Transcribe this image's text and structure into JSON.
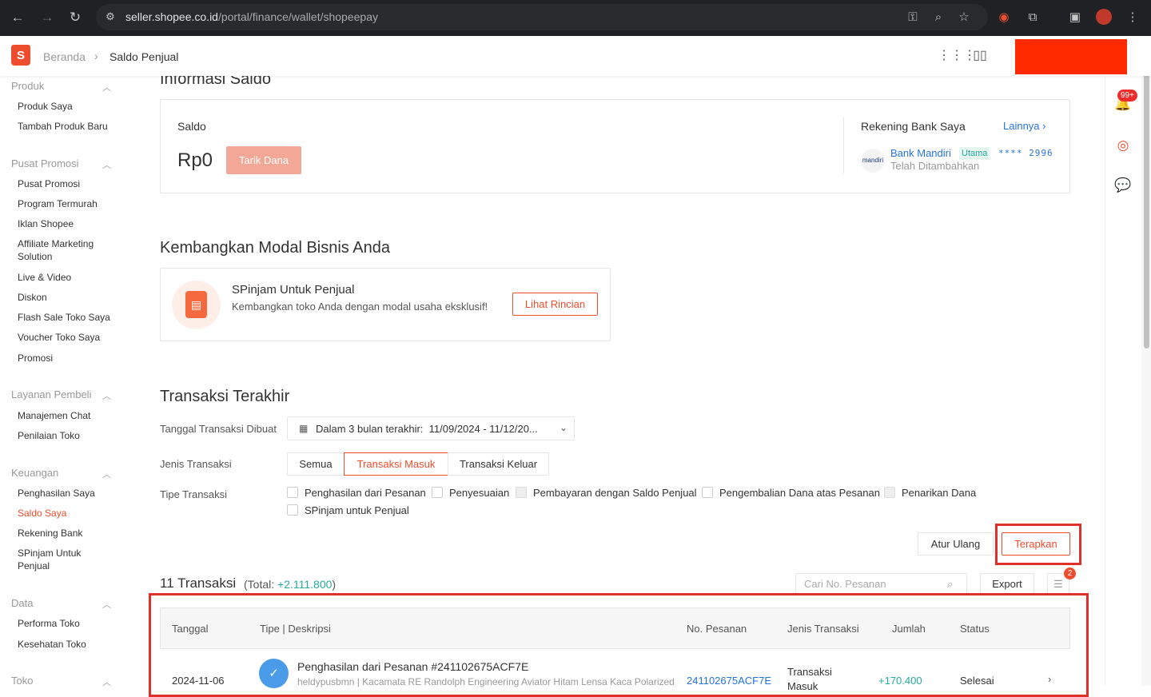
{
  "browser": {
    "url_host": "seller.shopee.co.id",
    "url_path": "/portal/finance/wallet/shopeepay"
  },
  "header": {
    "breadcrumb_home": "Beranda",
    "breadcrumb_current": "Saldo Penjual"
  },
  "sidebar": {
    "sections": [
      {
        "title": "Produk",
        "items": [
          "Produk Saya",
          "Tambah Produk Baru"
        ]
      },
      {
        "title": "Pusat Promosi",
        "items": [
          "Pusat Promosi",
          "Program Termurah",
          "Iklan Shopee",
          "Affiliate Marketing Solution",
          "Live & Video",
          "Diskon",
          "Flash Sale Toko Saya",
          "Voucher Toko Saya",
          "Promosi"
        ]
      },
      {
        "title": "Layanan Pembeli",
        "items": [
          "Manajemen Chat",
          "Penilaian Toko"
        ]
      },
      {
        "title": "Keuangan",
        "items": [
          "Penghasilan Saya",
          "Saldo Saya",
          "Rekening Bank",
          "SPinjam Untuk Penjual"
        ]
      },
      {
        "title": "Data",
        "items": [
          "Performa Toko",
          "Kesehatan Toko"
        ]
      },
      {
        "title": "Toko",
        "items": []
      }
    ],
    "active_item": "Saldo Saya"
  },
  "rail": {
    "notification_badge": "99+"
  },
  "info": {
    "title": "Informasi Saldo",
    "saldo_label": "Saldo",
    "amount": "Rp0",
    "withdraw_button": "Tarik Dana",
    "bank_title": "Rekening Bank Saya",
    "more_link": "Lainnya",
    "bank_logo_text": "mandiri",
    "bank_name": "Bank Mandiri",
    "bank_tag": "Utama",
    "bank_account": "**** 2996",
    "bank_status": "Telah Ditambahkan"
  },
  "capital": {
    "title": "Kembangkan Modal Bisnis Anda",
    "card_title": "SPinjam Untuk Penjual",
    "card_desc": "Kembangkan toko Anda dengan modal usaha eksklusif!",
    "card_button": "Lihat Rincian"
  },
  "transactions": {
    "title": "Transaksi Terakhir",
    "date_label": "Tanggal Transaksi Dibuat",
    "date_prefix": "Dalam 3 bulan terakhir:",
    "date_range": "11/09/2024 - 11/12/20...",
    "type_label": "Jenis Transaksi",
    "type_options": [
      "Semua",
      "Transaksi Masuk",
      "Transaksi Keluar"
    ],
    "type_selected": "Transaksi Masuk",
    "kind_label": "Tipe Transaksi",
    "kind_options": [
      "Penghasilan dari Pesanan",
      "Penyesuaian",
      "Pembayaran dengan Saldo Penjual",
      "Pengembalian Dana atas Pesanan",
      "Penarikan Dana",
      "SPinjam untuk Penjual"
    ],
    "reset_button": "Atur Ulang",
    "apply_button": "Terapkan",
    "count_text": "11 Transaksi",
    "total_prefix": "(Total: ",
    "total_value": "+2.111.800",
    "total_suffix": ")",
    "search_placeholder": "Cari No. Pesanan",
    "export_button": "Export",
    "filter_badge": "2",
    "columns": [
      "Tanggal",
      "Tipe | Deskripsi",
      "No. Pesanan",
      "Jenis Transaksi",
      "Jumlah",
      "Status"
    ],
    "rows": [
      {
        "date": "2024-11-06",
        "title": "Penghasilan dari Pesanan #241102675ACF7E",
        "desc": "heldypusbmn | Kacamata RE Randolph Engineering Aviator Hitam Lensa Kaca Polarized",
        "order_no": "241102675ACF7E",
        "type_line1": "Transaksi",
        "type_line2": "Masuk",
        "amount": "+170.400",
        "status": "Selesai"
      }
    ]
  },
  "colors": {
    "brand": "#ee4d2d",
    "link": "#2673dd",
    "positive": "#26aa99",
    "highlight": "#e0302a"
  }
}
